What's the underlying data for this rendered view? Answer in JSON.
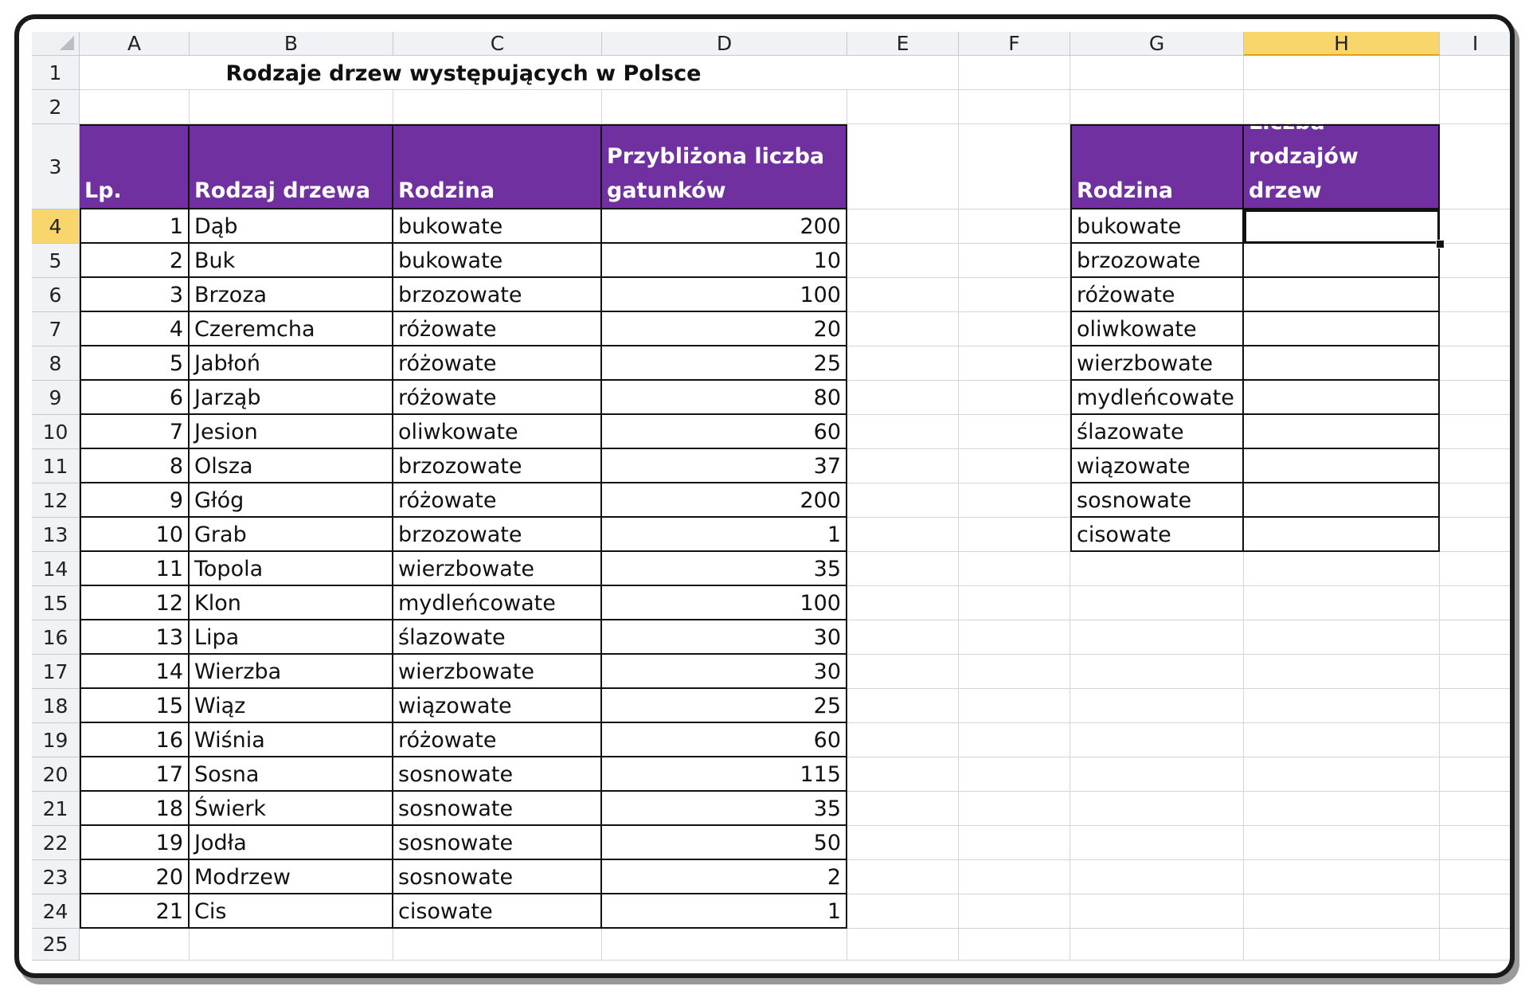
{
  "columns": [
    "A",
    "B",
    "C",
    "D",
    "E",
    "F",
    "G",
    "H",
    "I"
  ],
  "rows": [
    "1",
    "2",
    "3",
    "4",
    "5",
    "6",
    "7",
    "8",
    "9",
    "10",
    "11",
    "12",
    "13",
    "14",
    "15",
    "16",
    "17",
    "18",
    "19",
    "20",
    "21",
    "22",
    "23",
    "24",
    "25"
  ],
  "selected_column": "H",
  "selected_row": "4",
  "title": "Rodzaje drzew występujących w Polsce",
  "main_table": {
    "headers": [
      "Lp.",
      "Rodzaj drzewa",
      "Rodzina",
      "Przybliżona liczba gatunków"
    ],
    "rows": [
      [
        "1",
        "Dąb",
        "bukowate",
        "200"
      ],
      [
        "2",
        "Buk",
        "bukowate",
        "10"
      ],
      [
        "3",
        "Brzoza",
        "brzozowate",
        "100"
      ],
      [
        "4",
        "Czeremcha",
        "różowate",
        "20"
      ],
      [
        "5",
        "Jabłoń",
        "różowate",
        "25"
      ],
      [
        "6",
        "Jarząb",
        "różowate",
        "80"
      ],
      [
        "7",
        "Jesion",
        "oliwkowate",
        "60"
      ],
      [
        "8",
        "Olsza",
        "brzozowate",
        "37"
      ],
      [
        "9",
        "Głóg",
        "różowate",
        "200"
      ],
      [
        "10",
        "Grab",
        "brzozowate",
        "1"
      ],
      [
        "11",
        "Topola",
        "wierzbowate",
        "35"
      ],
      [
        "12",
        "Klon",
        "mydleńcowate",
        "100"
      ],
      [
        "13",
        "Lipa",
        "ślazowate",
        "30"
      ],
      [
        "14",
        "Wierzba",
        "wierzbowate",
        "30"
      ],
      [
        "15",
        "Wiąz",
        "wiązowate",
        "25"
      ],
      [
        "16",
        "Wiśnia",
        "różowate",
        "60"
      ],
      [
        "17",
        "Sosna",
        "sosnowate",
        "115"
      ],
      [
        "18",
        "Świerk",
        "sosnowate",
        "35"
      ],
      [
        "19",
        "Jodła",
        "sosnowate",
        "50"
      ],
      [
        "20",
        "Modrzew",
        "sosnowate",
        "2"
      ],
      [
        "21",
        "Cis",
        "cisowate",
        "1"
      ]
    ]
  },
  "summary_table": {
    "headers": [
      "Rodzina",
      "Liczba rodzajów drzew"
    ],
    "rows": [
      [
        "bukowate",
        ""
      ],
      [
        "brzozowate",
        ""
      ],
      [
        "różowate",
        ""
      ],
      [
        "oliwkowate",
        ""
      ],
      [
        "wierzbowate",
        ""
      ],
      [
        "mydleńcowate",
        ""
      ],
      [
        "ślazowate",
        ""
      ],
      [
        "wiązowate",
        ""
      ],
      [
        "sosnowate",
        ""
      ],
      [
        "cisowate",
        ""
      ]
    ]
  },
  "colors": {
    "header_fill": "#7030a0",
    "header_text": "#ffffff",
    "selection_highlight": "#f9d66b",
    "headings_bg": "#f0f2f5"
  }
}
